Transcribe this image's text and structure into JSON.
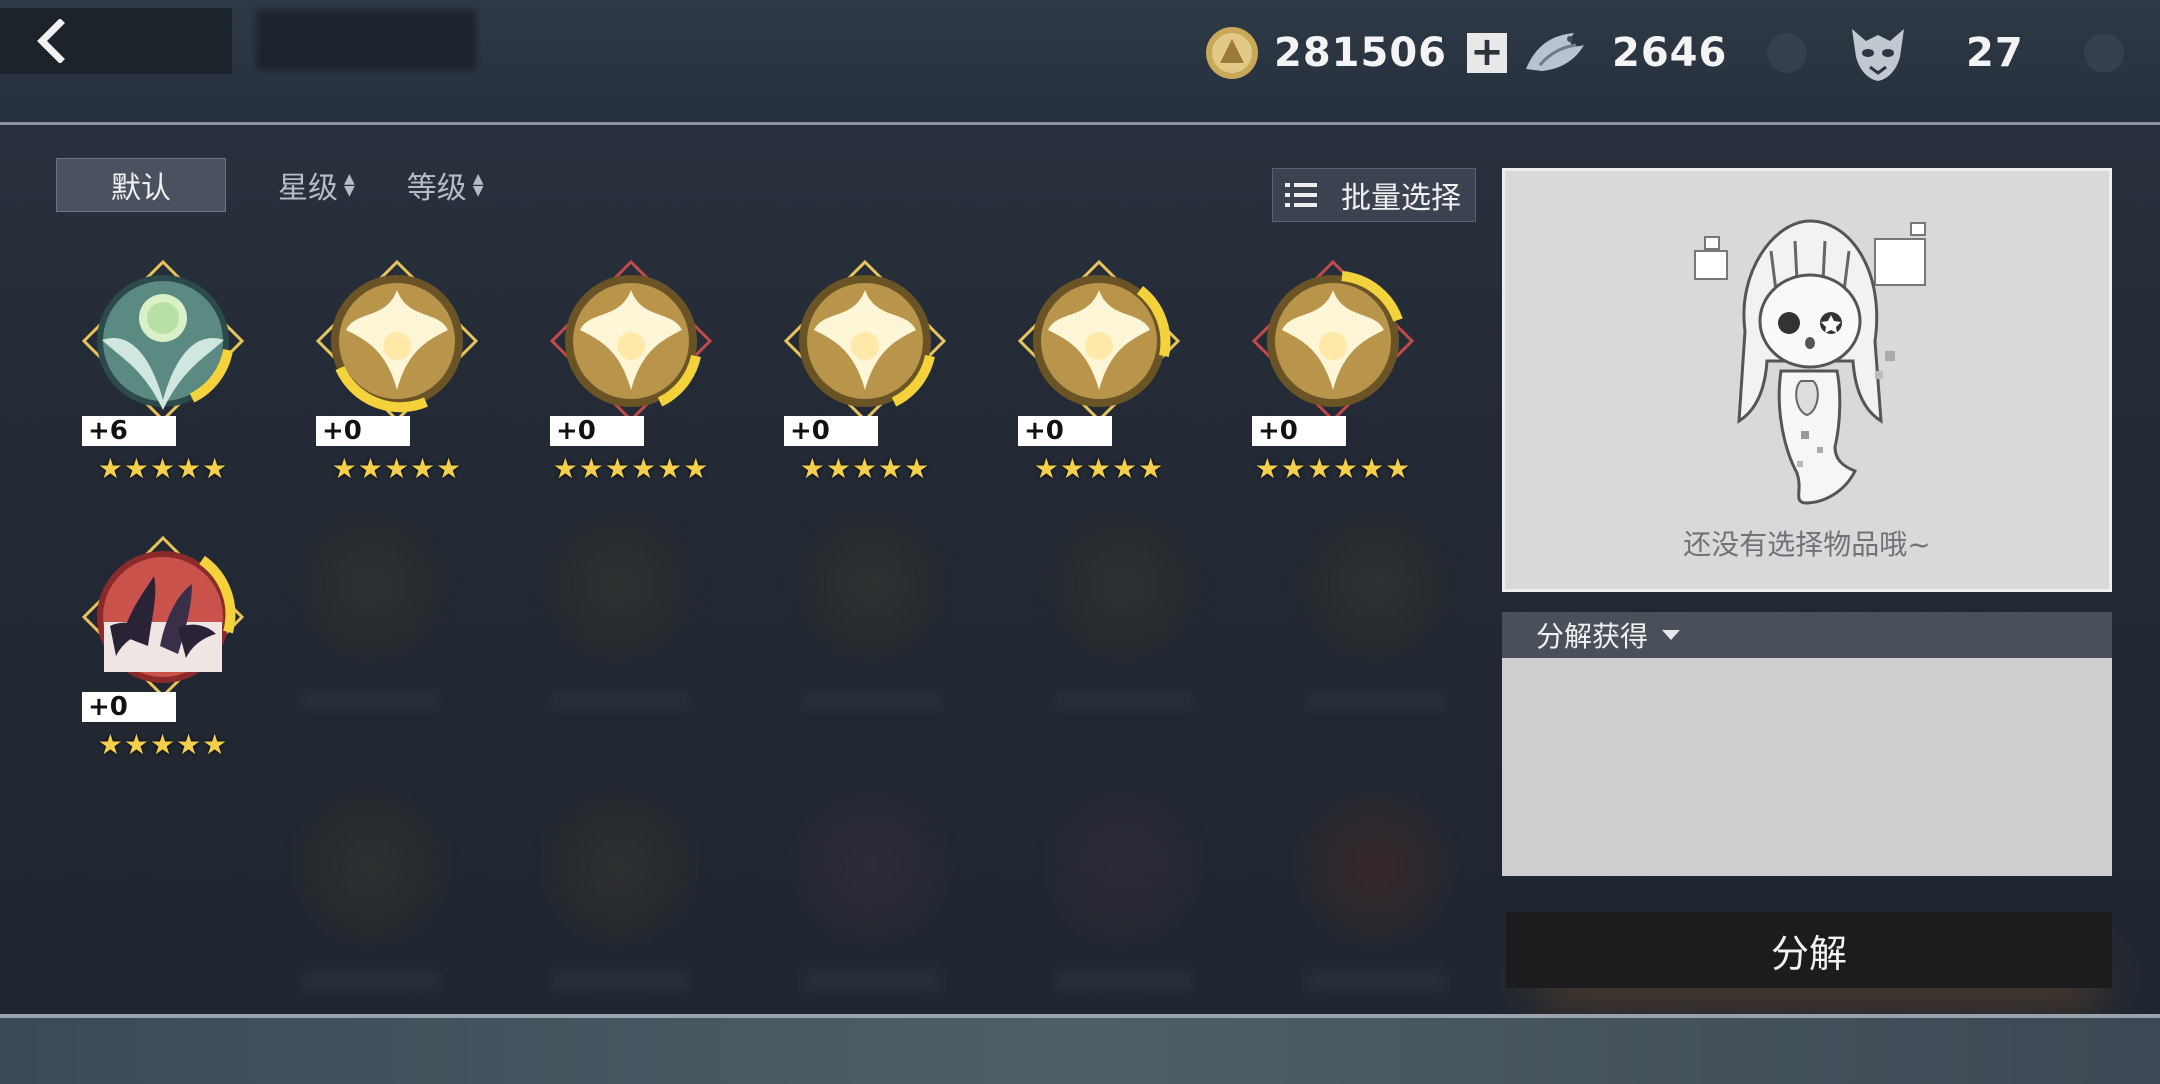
{
  "topbar": {
    "currencies": [
      {
        "icon": "gold-coin-icon",
        "value": "281506"
      },
      {
        "icon": "silver-dragon-icon",
        "value": "2646"
      },
      {
        "icon": "demon-mask-icon",
        "value": "27"
      }
    ],
    "plus_label": "+"
  },
  "sort": {
    "default_label": "默认",
    "star_label": "星级",
    "level_label": "等级"
  },
  "batch_select_label": "批量选择",
  "items": [
    {
      "icon": "jade-emblem-icon",
      "level": "+6",
      "stars": "★★★★★",
      "frame": "#e8c45a"
    },
    {
      "icon": "golden-wings-emblem-icon",
      "level": "+0",
      "stars": "★★★★★",
      "frame": "#e8c45a"
    },
    {
      "icon": "golden-wings-emblem-icon",
      "level": "+0",
      "stars": "★★★★★★",
      "frame": "#c24a4a"
    },
    {
      "icon": "golden-wings-emblem-icon",
      "level": "+0",
      "stars": "★★★★★",
      "frame": "#e8c45a"
    },
    {
      "icon": "golden-wings-emblem-icon",
      "level": "+0",
      "stars": "★★★★★",
      "frame": "#e8c45a"
    },
    {
      "icon": "golden-wings-emblem-icon",
      "level": "+0",
      "stars": "★★★★★★",
      "frame": "#c24a4a"
    },
    {
      "icon": "shadow-dragons-emblem-icon",
      "level": "+0",
      "stars": "★★★★★",
      "frame": "#e8c45a"
    }
  ],
  "preview": {
    "empty_text": "还没有选择物品哦~"
  },
  "decompose": {
    "header_label": "分解获得",
    "button_label": "分解"
  }
}
